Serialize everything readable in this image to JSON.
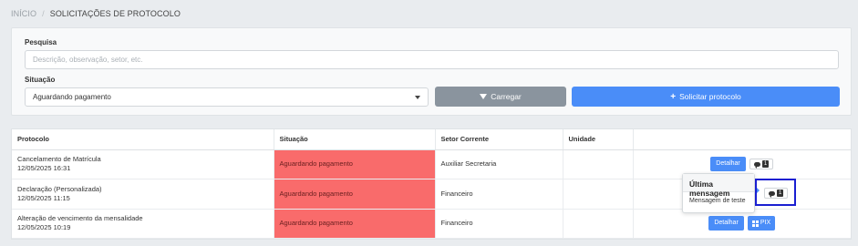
{
  "breadcrumb": {
    "home": "INÍCIO",
    "separator": "/",
    "current": "SOLICITAÇÕES DE PROTOCOLO"
  },
  "filters": {
    "search_label": "Pesquisa",
    "search_placeholder": "Descrição, observação, setor, etc.",
    "search_value": "",
    "situation_label": "Situação",
    "situation_value": "Aguardando pagamento",
    "load_button": "Carregar",
    "request_button": "Solicitar protocolo"
  },
  "table": {
    "headers": [
      "Protocolo",
      "Situação",
      "Setor Corrente",
      "Unidade",
      ""
    ],
    "rows": [
      {
        "title": "Cancelamento de Matrícula",
        "date": "12/05/2025 16:31",
        "situation": "Aguardando pagamento",
        "sector": "Auxiliar Secretaria",
        "unit": "",
        "detail": "Detalhar",
        "msg_count": "1"
      },
      {
        "title": "Declaração (Personalizada)",
        "date": "12/05/2025 11:15",
        "situation": "Aguardando pagamento",
        "sector": "Financeiro",
        "unit": ""
      },
      {
        "title": "Alteração de vencimento da mensalidade",
        "date": "12/05/2025 10:19",
        "situation": "Aguardando pagamento",
        "sector": "Financeiro",
        "unit": "",
        "detail": "Detalhar",
        "pix": "PIX"
      }
    ]
  },
  "popover": {
    "title": "Última mensagem",
    "body": "Mensagem de teste"
  },
  "highlight": {
    "msg_count": "1",
    "color": "#1a1fd1"
  },
  "colors": {
    "primary": "#4a8df8",
    "secondary": "#8a949e",
    "danger": "#f96b6b"
  }
}
